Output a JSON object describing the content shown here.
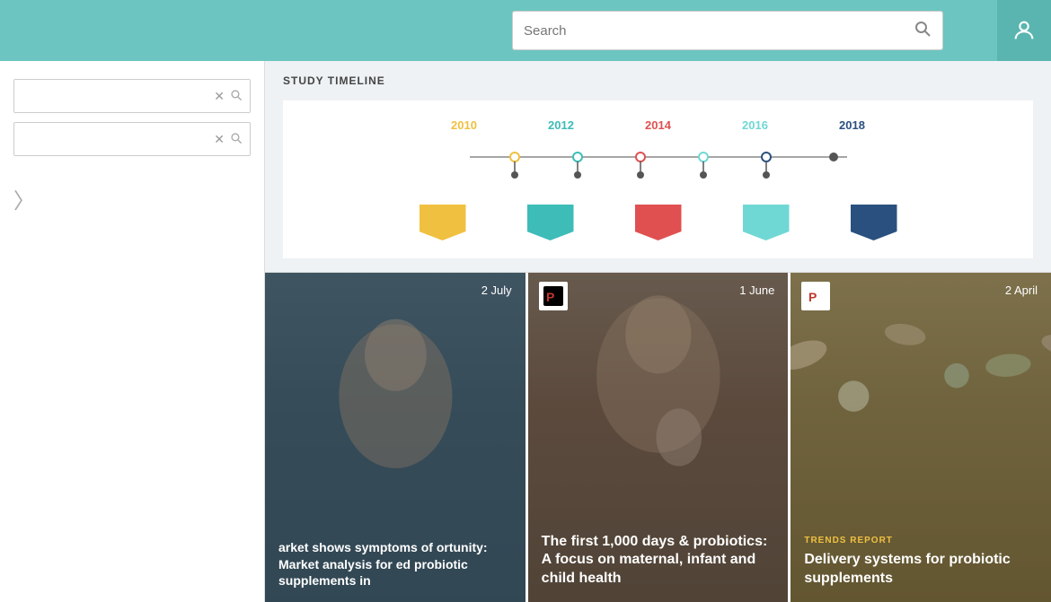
{
  "header": {
    "search_placeholder": "Search",
    "user_icon_label": "User account"
  },
  "sidebar": {
    "filter1_placeholder": "",
    "filter2_placeholder": ""
  },
  "timeline": {
    "section_title": "STUDY TIMELINE",
    "years": [
      {
        "label": "2010",
        "color": "#f0c040"
      },
      {
        "label": "2012",
        "color": "#3dbcb8"
      },
      {
        "label": "2014",
        "color": "#e05050"
      },
      {
        "label": "2016",
        "color": "#70d8d4"
      },
      {
        "label": "2018",
        "color": "#2a5080"
      }
    ],
    "arrows": [
      {
        "color": "#f0c040"
      },
      {
        "color": "#3dbcb8"
      },
      {
        "color": "#e05050"
      },
      {
        "color": "#70d8d4"
      },
      {
        "color": "#2a5080"
      }
    ]
  },
  "cards": [
    {
      "date": "2 July",
      "has_icon": false,
      "tag": "",
      "title": "arket shows symptoms of ortunity: Market analysis for ed probiotic supplements in",
      "bg": "blue"
    },
    {
      "date": "1 June",
      "has_icon": true,
      "tag": "",
      "title": "The first 1,000 days & probiotics: A focus on maternal, infant and child health",
      "bg": "taupe"
    },
    {
      "date": "2 April",
      "has_icon": true,
      "tag": "TRENDS REPORT",
      "title": "Delivery systems for probiotic supplements",
      "bg": "warm"
    }
  ]
}
